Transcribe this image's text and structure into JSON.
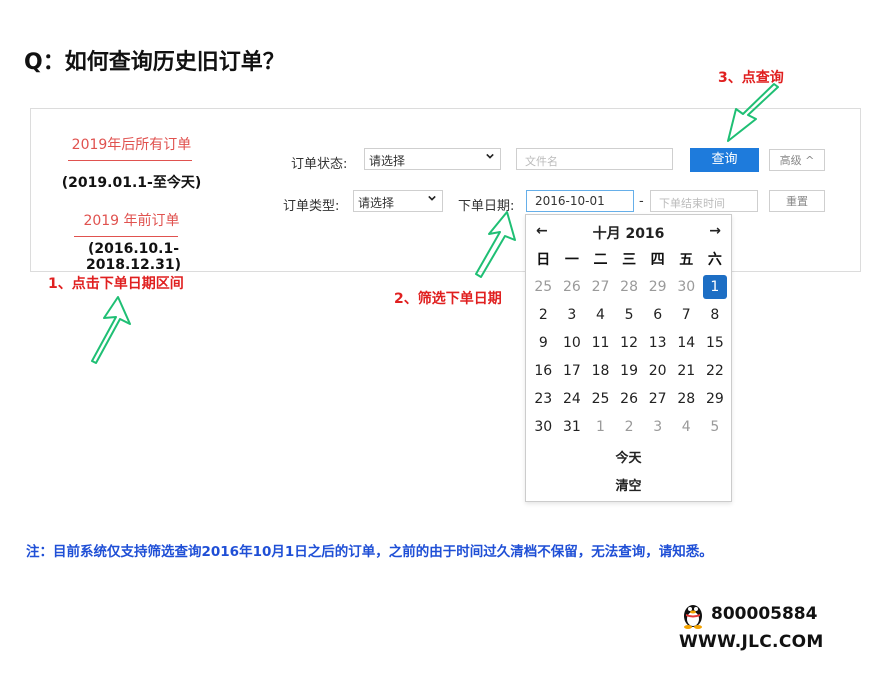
{
  "title": "Q：如何查询历史旧订单？",
  "periods": {
    "after_link": "2019年后所有订单",
    "after_range": "(2019.01.1-至今天)",
    "before_link": "2019 年前订单",
    "before_range": "(2016.10.1-2018.12.31)"
  },
  "filters": {
    "status_label": "订单状态:",
    "status_value": "请选择",
    "filename_placeholder": "文件名",
    "type_label": "订单类型:",
    "type_value": "请选择",
    "date_label": "下单日期:",
    "date_start": "2016-10-01",
    "date_sep": "-",
    "date_end_placeholder": "下单结束时间",
    "search_button": "查询",
    "advanced_button": "高级 ^",
    "reset_button": "重置"
  },
  "annotations": {
    "step1": "1、点击下单日期区间",
    "step2": "2、筛选下单日期",
    "step3": "3、点查询",
    "arrow_color": "#1fbf74"
  },
  "calendar": {
    "prev": "←",
    "next": "→",
    "title": "十月 2016",
    "weekdays": [
      "日",
      "一",
      "二",
      "三",
      "四",
      "五",
      "六"
    ],
    "weeks": [
      [
        "25",
        "26",
        "27",
        "28",
        "29",
        "30",
        "1"
      ],
      [
        "2",
        "3",
        "4",
        "5",
        "6",
        "7",
        "8"
      ],
      [
        "9",
        "10",
        "11",
        "12",
        "13",
        "14",
        "15"
      ],
      [
        "16",
        "17",
        "18",
        "19",
        "20",
        "21",
        "22"
      ],
      [
        "23",
        "24",
        "25",
        "26",
        "27",
        "28",
        "29"
      ],
      [
        "30",
        "31",
        "1",
        "2",
        "3",
        "4",
        "5"
      ]
    ],
    "selected_day": "1",
    "today_button": "今天",
    "clear_button": "清空"
  },
  "note": "注：目前系统仅支持筛选查询2016年10月1日之后的订单，之前的由于时间过久清档不保留，无法查询，请知悉。",
  "contact": {
    "phone": "800005884",
    "website": "WWW.JLC.COM"
  },
  "colors": {
    "primary_button": "#1e7bdc",
    "period_link": "#e0524f",
    "annotation_text": "#e02020",
    "note_text": "#1f4fd6"
  }
}
